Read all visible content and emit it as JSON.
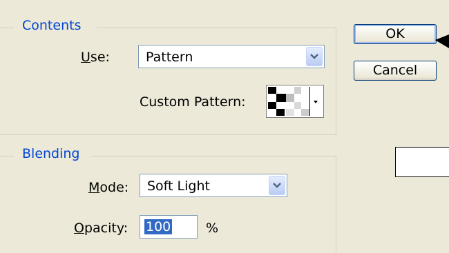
{
  "contents": {
    "group_title": "Contents",
    "use_label_mnemonic": "U",
    "use_label_rest": "se:",
    "use_value": "Pattern",
    "custom_pattern_label": "Custom Pattern:"
  },
  "blending": {
    "group_title": "Blending",
    "mode_label_mnemonic": "M",
    "mode_label_rest": "ode:",
    "mode_value": "Soft Light",
    "opacity_label_mnemonic": "O",
    "opacity_label_rest": "pacity:",
    "opacity_value": "100",
    "opacity_unit": "%"
  },
  "buttons": {
    "ok": "OK",
    "cancel": "Cancel"
  },
  "colors": {
    "group_title": "#0046d5",
    "selection": "#316ac5",
    "dialog_bg": "#ece9d8"
  },
  "icons": {
    "dropdown": "chevron-down-icon",
    "arrow": "arrow-pointer-icon"
  }
}
